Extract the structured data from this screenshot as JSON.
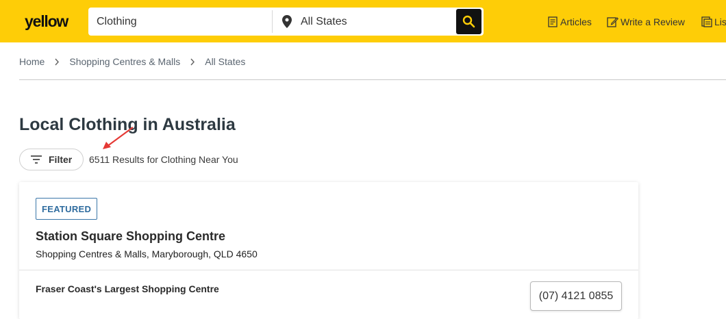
{
  "header": {
    "logo_text": "yellow",
    "brand_color": "#fecd07",
    "search": {
      "what_value": "Clothing",
      "where_value": "All States",
      "search_icon": "search-icon",
      "location_icon": "map-pin-icon"
    },
    "nav": [
      {
        "label": "Articles",
        "icon": "articles-icon"
      },
      {
        "label": "Write a Review",
        "icon": "edit-icon"
      },
      {
        "label": "Lis",
        "icon": "list-icon"
      }
    ]
  },
  "breadcrumb": [
    "Home",
    "Shopping Centres & Malls",
    "All States"
  ],
  "main": {
    "title": "Local Clothing in Australia",
    "filter_label": "Filter",
    "results_text": "6511 Results for Clothing Near You",
    "annotation_color": "#e53935"
  },
  "listing": {
    "badge": "FEATURED",
    "name": "Station Square Shopping Centre",
    "address": "Shopping Centres & Malls, Maryborough, QLD 4650",
    "tagline": "Fraser Coast's Largest Shopping Centre",
    "phone": "(07) 4121 0855"
  }
}
